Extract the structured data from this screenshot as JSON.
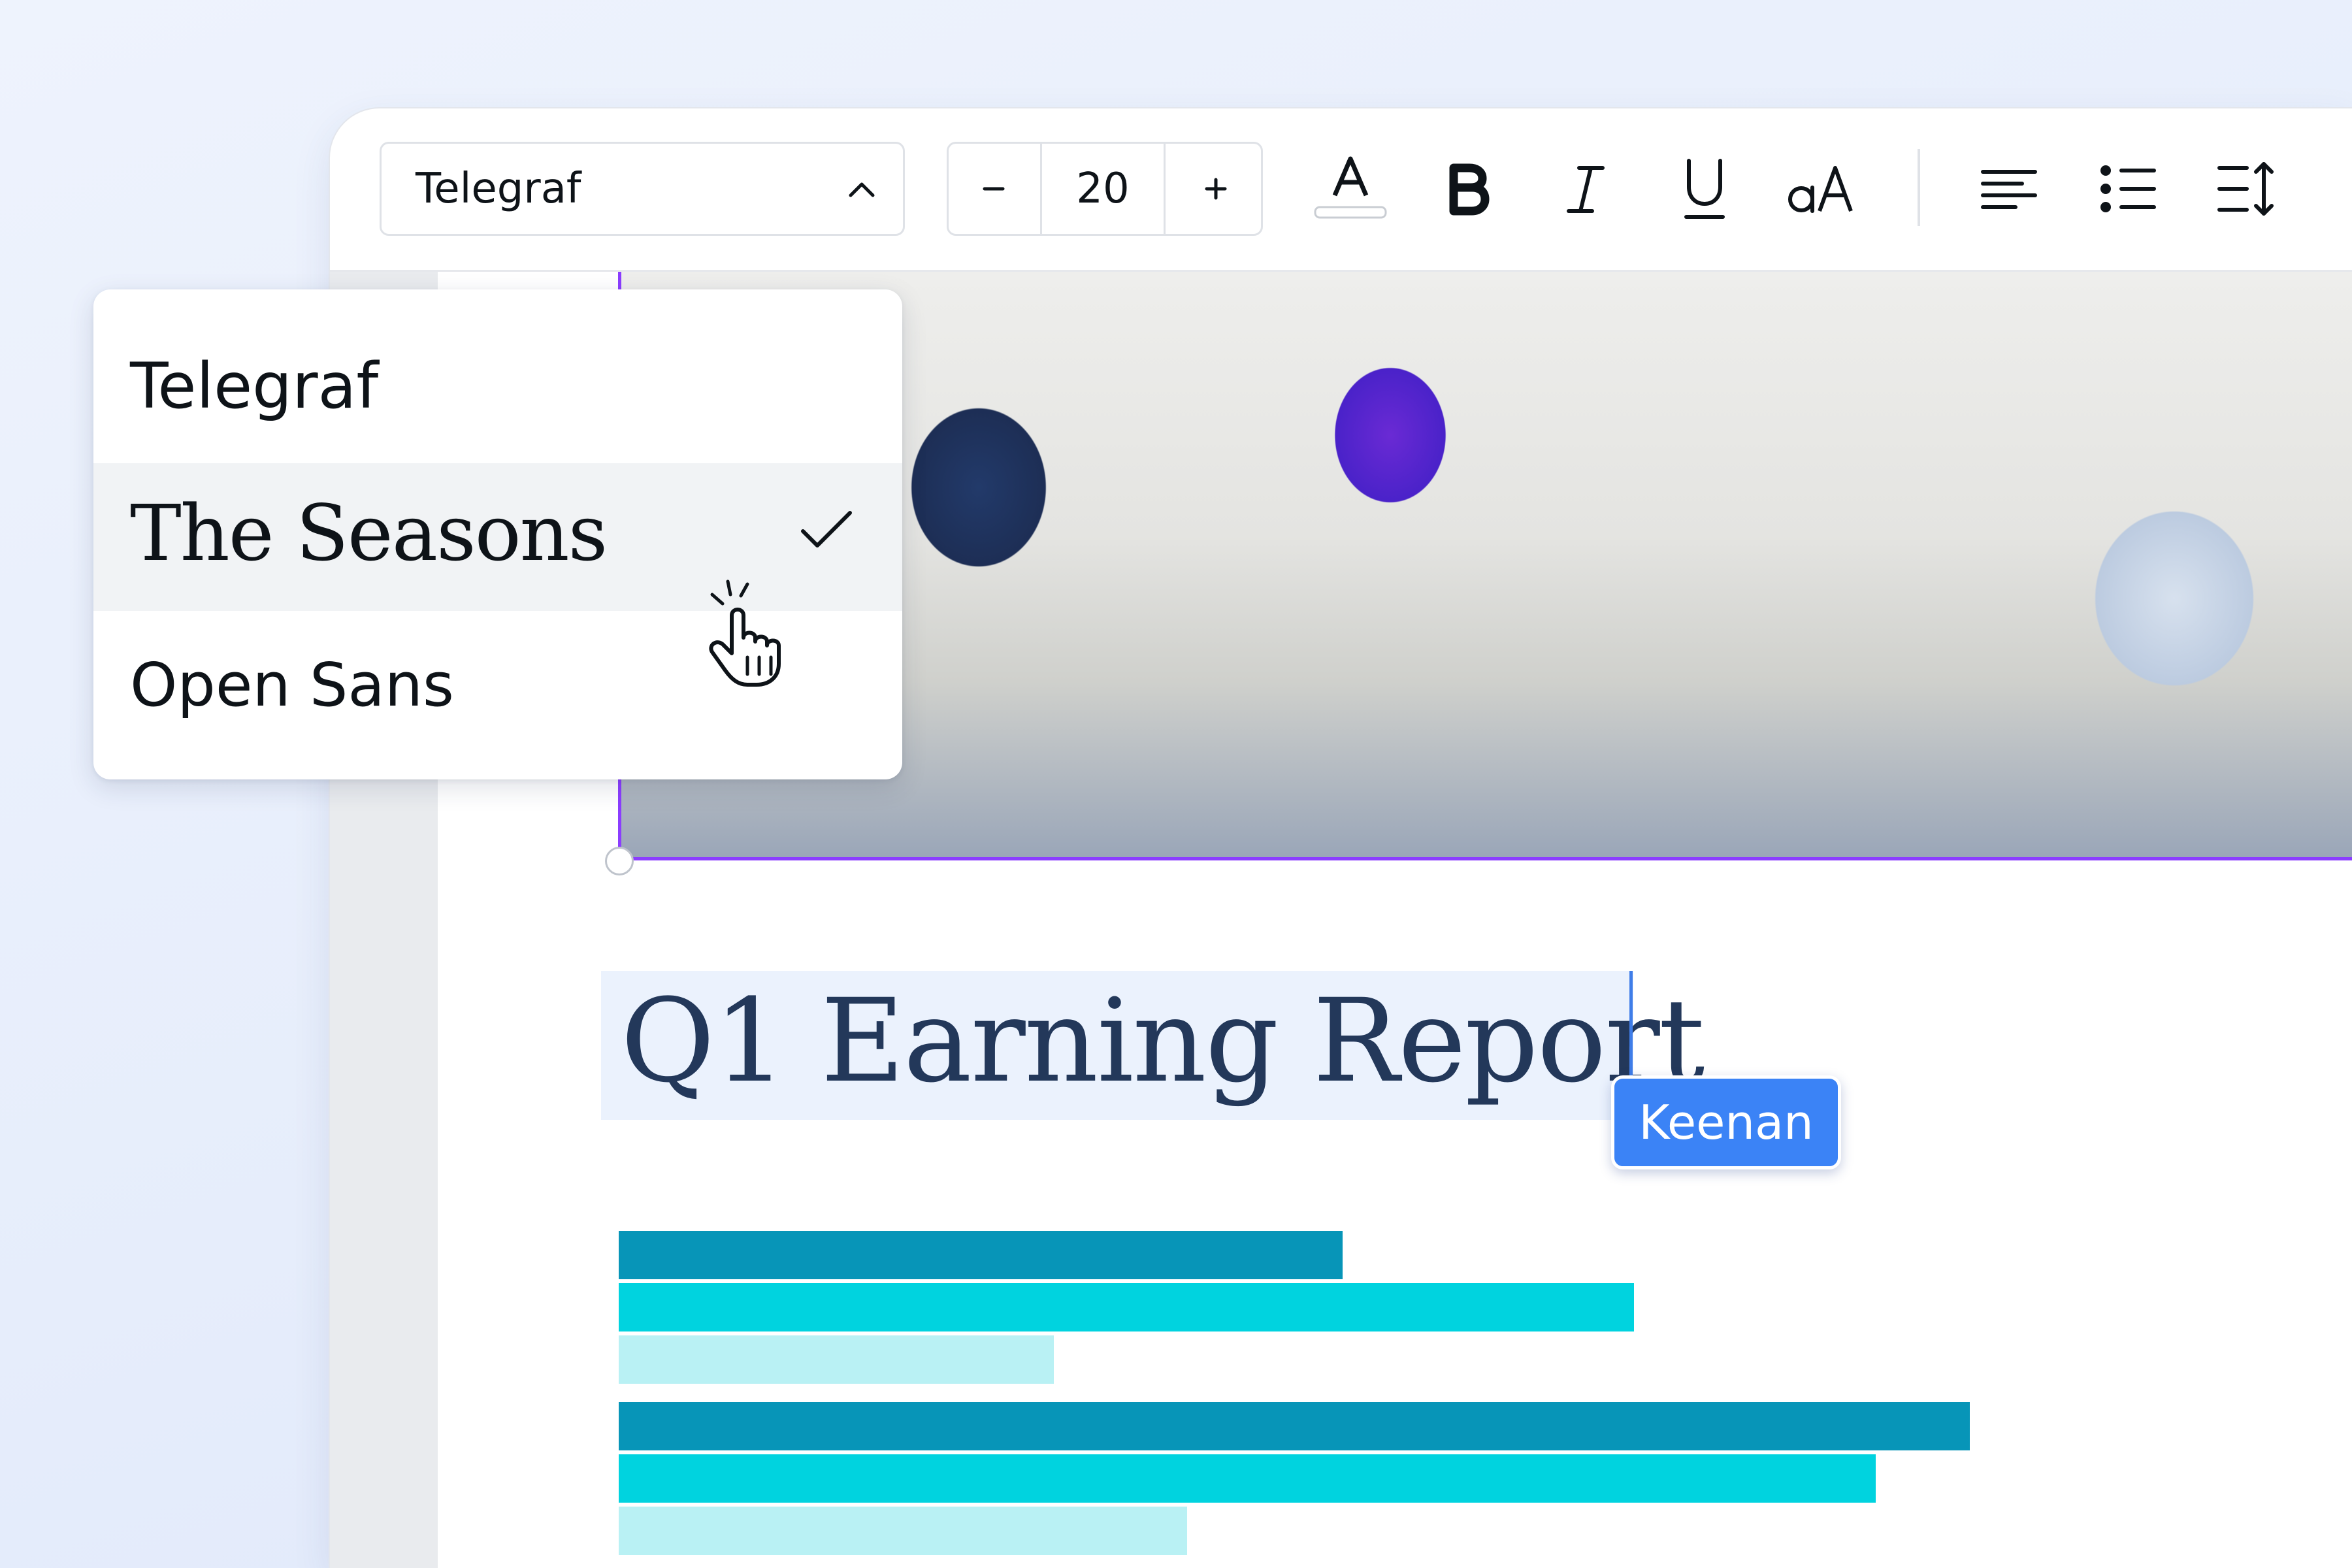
{
  "toolbar": {
    "font_family": "Telegraf",
    "font_size": "20",
    "tools": [
      {
        "icon": "text-color-icon"
      },
      {
        "icon": "bold-icon"
      },
      {
        "icon": "italic-icon"
      },
      {
        "icon": "underline-icon"
      },
      {
        "icon": "letter-case-icon"
      },
      {
        "icon": "align-left-icon"
      },
      {
        "icon": "bulleted-list-icon"
      },
      {
        "icon": "line-spacing-icon"
      }
    ]
  },
  "font_dropdown": {
    "items": [
      {
        "label": "Telegraf",
        "selected": false
      },
      {
        "label": "The Seasons",
        "selected": true
      },
      {
        "label": "Open Sans",
        "selected": false
      }
    ]
  },
  "document": {
    "heading": "Q1 Earning Report",
    "collaborator": "Keenan"
  },
  "colors": {
    "selection": "#8b3dff",
    "collaborator": "#3b83f6",
    "heading": "#23385a",
    "bar_dark": "#0795b8",
    "bar_mid": "#00d3df",
    "bar_light": "#b9f1f4"
  }
}
